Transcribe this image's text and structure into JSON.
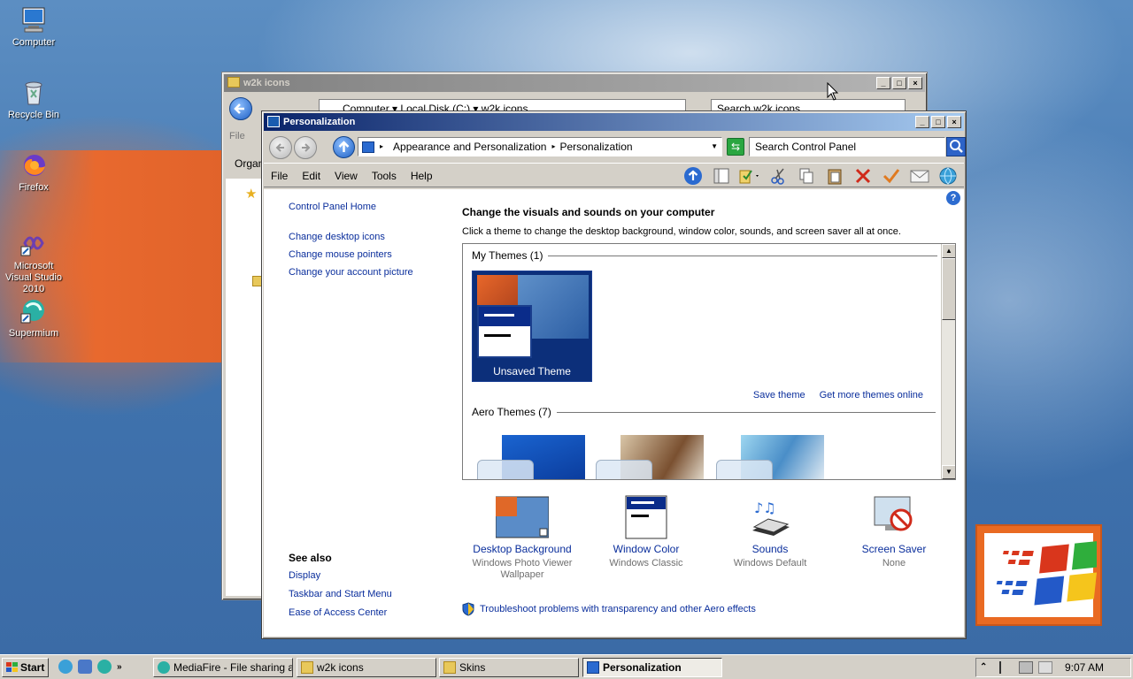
{
  "desktop": {
    "icons": [
      {
        "label": "Computer"
      },
      {
        "label": "Recycle Bin"
      },
      {
        "label": "Firefox"
      },
      {
        "label": "Microsoft Visual Studio 2010"
      },
      {
        "label": "Supermium"
      }
    ]
  },
  "back_window": {
    "title": "w2k icons",
    "breadcrumb": [
      "Computer",
      "Local Disk (C:)",
      "w2k icons"
    ],
    "search_placeholder": "Search w2k icons",
    "menu_first": "File",
    "organize": "Organ"
  },
  "window": {
    "title": "Personalization",
    "breadcrumb": [
      "Appearance and Personalization",
      "Personalization"
    ],
    "search_placeholder": "Search Control Panel",
    "menu": [
      "File",
      "Edit",
      "View",
      "Tools",
      "Help"
    ],
    "left_nav": {
      "home": "Control Panel Home",
      "links": [
        "Change desktop icons",
        "Change mouse pointers",
        "Change your account picture"
      ]
    },
    "see_also": {
      "title": "See also",
      "links": [
        "Display",
        "Taskbar and Start Menu",
        "Ease of Access Center"
      ]
    },
    "heading": "Change the visuals and sounds on your computer",
    "subheading": "Click a theme to change the desktop background, window color, sounds, and screen saver all at once.",
    "my_themes": {
      "label": "My Themes (1)",
      "items": [
        "Unsaved Theme"
      ],
      "save": "Save theme",
      "more": "Get more themes online"
    },
    "aero_themes": {
      "label": "Aero Themes (7)"
    },
    "bottom_items": [
      {
        "title": "Desktop Background",
        "subtitle": "Windows Photo Viewer Wallpaper"
      },
      {
        "title": "Window Color",
        "subtitle": "Windows Classic"
      },
      {
        "title": "Sounds",
        "subtitle": "Windows Default"
      },
      {
        "title": "Screen Saver",
        "subtitle": "None"
      }
    ],
    "troubleshoot": "Troubleshoot problems with transparency and other Aero effects"
  },
  "taskbar": {
    "start": "Start",
    "buttons": [
      {
        "label": "MediaFire - File sharing a..."
      },
      {
        "label": "w2k icons"
      },
      {
        "label": "Skins"
      },
      {
        "label": "Personalization"
      }
    ],
    "clock": "9:07 AM"
  },
  "colors": {
    "title_active": "#0a246a",
    "title_gradient_end": "#a6caf0",
    "link": "#0a2e9c",
    "desktop": "#3a6ea5",
    "orange": "#e8692e"
  }
}
